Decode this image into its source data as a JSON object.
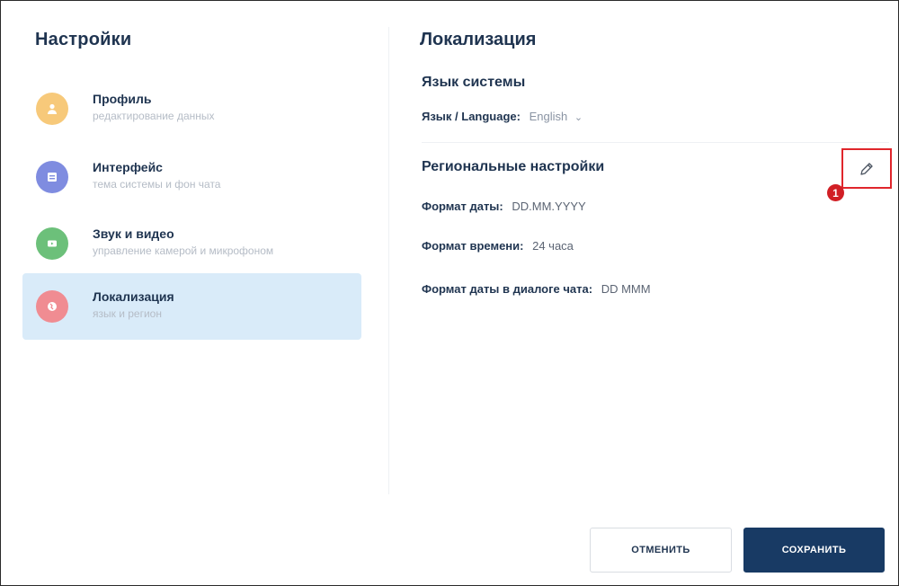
{
  "sidebar": {
    "title": "Настройки",
    "items": [
      {
        "label": "Профиль",
        "sub": "редактирование данных",
        "icon": "person-icon",
        "color": "#f7c97a"
      },
      {
        "label": "Интерфейс",
        "sub": "тема системы и фон чата",
        "icon": "window-icon",
        "color": "#7f8ce0"
      },
      {
        "label": "Звук и видео",
        "sub": "управление камерой и микрофоном",
        "icon": "video-icon",
        "color": "#6cc07a"
      },
      {
        "label": "Локализация",
        "sub": "язык и регион",
        "icon": "globe-icon",
        "color": "#f08c92",
        "active": true
      }
    ]
  },
  "main": {
    "title": "Локализация",
    "system_language": {
      "title": "Язык системы",
      "label": "Язык / Language:",
      "value": "English"
    },
    "regional": {
      "title": "Региональные настройки",
      "date_format_label": "Формат даты:",
      "date_format_value": "DD.MM.YYYY",
      "time_format_label": "Формат времени:",
      "time_format_value": "24 часа",
      "chat_date_label": "Формат даты в диалоге чата:",
      "chat_date_value": "DD MMM"
    },
    "edit_marker": "1"
  },
  "footer": {
    "cancel_label": "ОТМЕНИТЬ",
    "save_label": "СОХРАНИТЬ"
  },
  "colors": {
    "accent": "#183a64",
    "active_bg": "#d9ebf9",
    "highlight": "#e0262c"
  }
}
